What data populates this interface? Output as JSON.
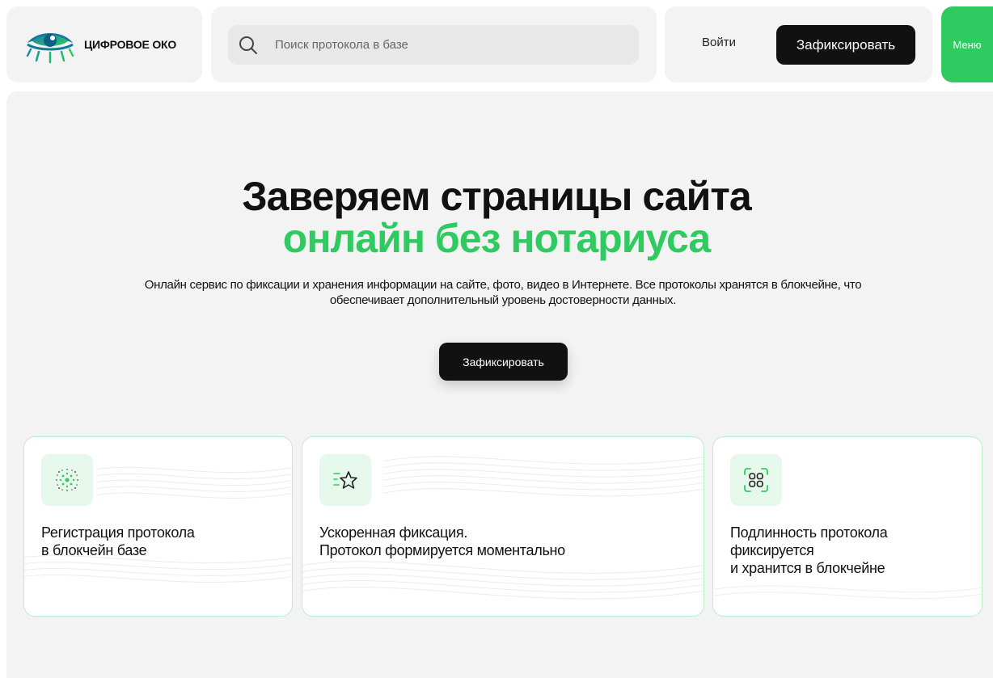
{
  "brand": {
    "name": "ЦИФРОВОЕ ОКО",
    "logo_icon": "eye-logo-icon"
  },
  "search": {
    "icon": "search-icon",
    "placeholder": "Поиск протокола в базе"
  },
  "nav": {
    "login_label": "Войти",
    "fix_label": "Зафиксировать",
    "menu_label": "Меню"
  },
  "hero": {
    "title": "Заверяем страницы сайта",
    "title_accent": "онлайн без нотариуса",
    "description": "Онлайн сервис по фиксации и хранения информации на сайте, фото, видео в Интернете. Все протоколы хранятся в блокчейне, что обеспечивает дополнительный уровень достоверности данных.",
    "cta_label": "Зафиксировать"
  },
  "features": [
    {
      "icon": "network-dots-icon",
      "text": "Регистрация протокола\nв блокчейн базе"
    },
    {
      "icon": "star-speed-icon",
      "text": "Ускоренная фиксация.\nПротокол формируется моментально"
    },
    {
      "icon": "scan-frame-icon",
      "text": "Подлинность протокола\nфиксируется\nи хранится в блокчейне"
    }
  ],
  "colors": {
    "accent": "#2fcb60",
    "dark": "#111111",
    "panel": "#f3f3f3",
    "card_border": "#b7efc8",
    "icon_bg": "#e6f8ec"
  }
}
